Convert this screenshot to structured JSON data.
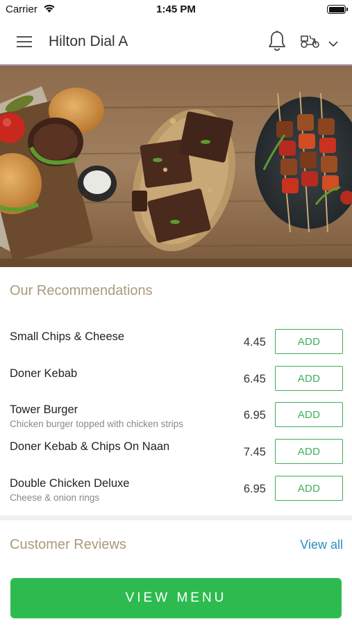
{
  "status_bar": {
    "carrier": "Carrier",
    "time": "1:45 PM",
    "battery_level": 1.0
  },
  "header": {
    "title": "Hilton Dial A",
    "icons": [
      "menu-icon",
      "bell-icon",
      "delivery-scooter-icon",
      "chevron-down-icon"
    ]
  },
  "hero": {
    "image": "food-banner: burgers, brownies, skewers on wooden table"
  },
  "recommendations": {
    "title": "Our Recommendations",
    "items": [
      {
        "name": "Small Chips & Cheese",
        "description": "",
        "price": "4.45",
        "button": "ADD"
      },
      {
        "name": "Doner Kebab",
        "description": "",
        "price": "6.45",
        "button": "ADD"
      },
      {
        "name": "Tower Burger",
        "description": "Chicken burger topped with chicken strips",
        "price": "6.95",
        "button": "ADD"
      },
      {
        "name": "Doner Kebab & Chips On Naan",
        "description": "",
        "price": "7.45",
        "button": "ADD"
      },
      {
        "name": "Double Chicken Deluxe",
        "description": "Cheese & onion rings",
        "price": "6.95",
        "button": "ADD"
      }
    ]
  },
  "reviews": {
    "title": "Customer Reviews",
    "view_all": "View all"
  },
  "footer": {
    "view_menu": "VIEW MENU"
  },
  "colors": {
    "accent_green": "#2dbb50",
    "add_green": "#3fae58",
    "section_title": "#a99b7a",
    "link_blue": "#2b8fbf",
    "header_border": "#b9a9cf"
  }
}
